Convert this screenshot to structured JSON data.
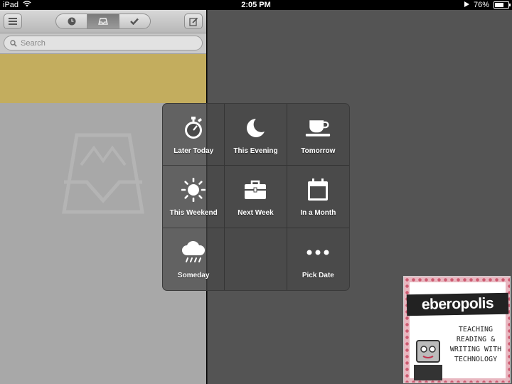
{
  "status_bar": {
    "device": "iPad",
    "time": "2:05 PM",
    "battery_percent_label": "76%",
    "battery_level": 0.76
  },
  "toolbar": {
    "menu_icon": "hamburger-icon",
    "segments": [
      {
        "icon": "clock-icon",
        "active": false
      },
      {
        "icon": "inbox-icon",
        "active": true
      },
      {
        "icon": "checkmark-icon",
        "active": false
      }
    ],
    "compose_icon": "compose-icon"
  },
  "search": {
    "placeholder": "Search"
  },
  "popup": {
    "options": [
      {
        "label": "Later Today",
        "icon": "stopwatch-icon"
      },
      {
        "label": "This Evening",
        "icon": "moon-icon"
      },
      {
        "label": "Tomorrow",
        "icon": "coffee-cup-icon"
      },
      {
        "label": "This Weekend",
        "icon": "sun-icon"
      },
      {
        "label": "Next Week",
        "icon": "briefcase-icon"
      },
      {
        "label": "In a Month",
        "icon": "calendar-icon"
      },
      {
        "label": "Someday",
        "icon": "rain-cloud-icon"
      },
      {
        "label": "",
        "icon": ""
      },
      {
        "label": "Pick Date",
        "icon": "more-dots-icon"
      }
    ]
  },
  "ad": {
    "brand": "eberopolis",
    "tagline_lines": [
      "TEACHING",
      "READING &",
      "WRITING WITH",
      "TECHNOLOGY"
    ]
  },
  "colors": {
    "highlight_row": "#c3ad5e",
    "right_panel": "#545454",
    "left_panel": "#a8a8a8"
  }
}
